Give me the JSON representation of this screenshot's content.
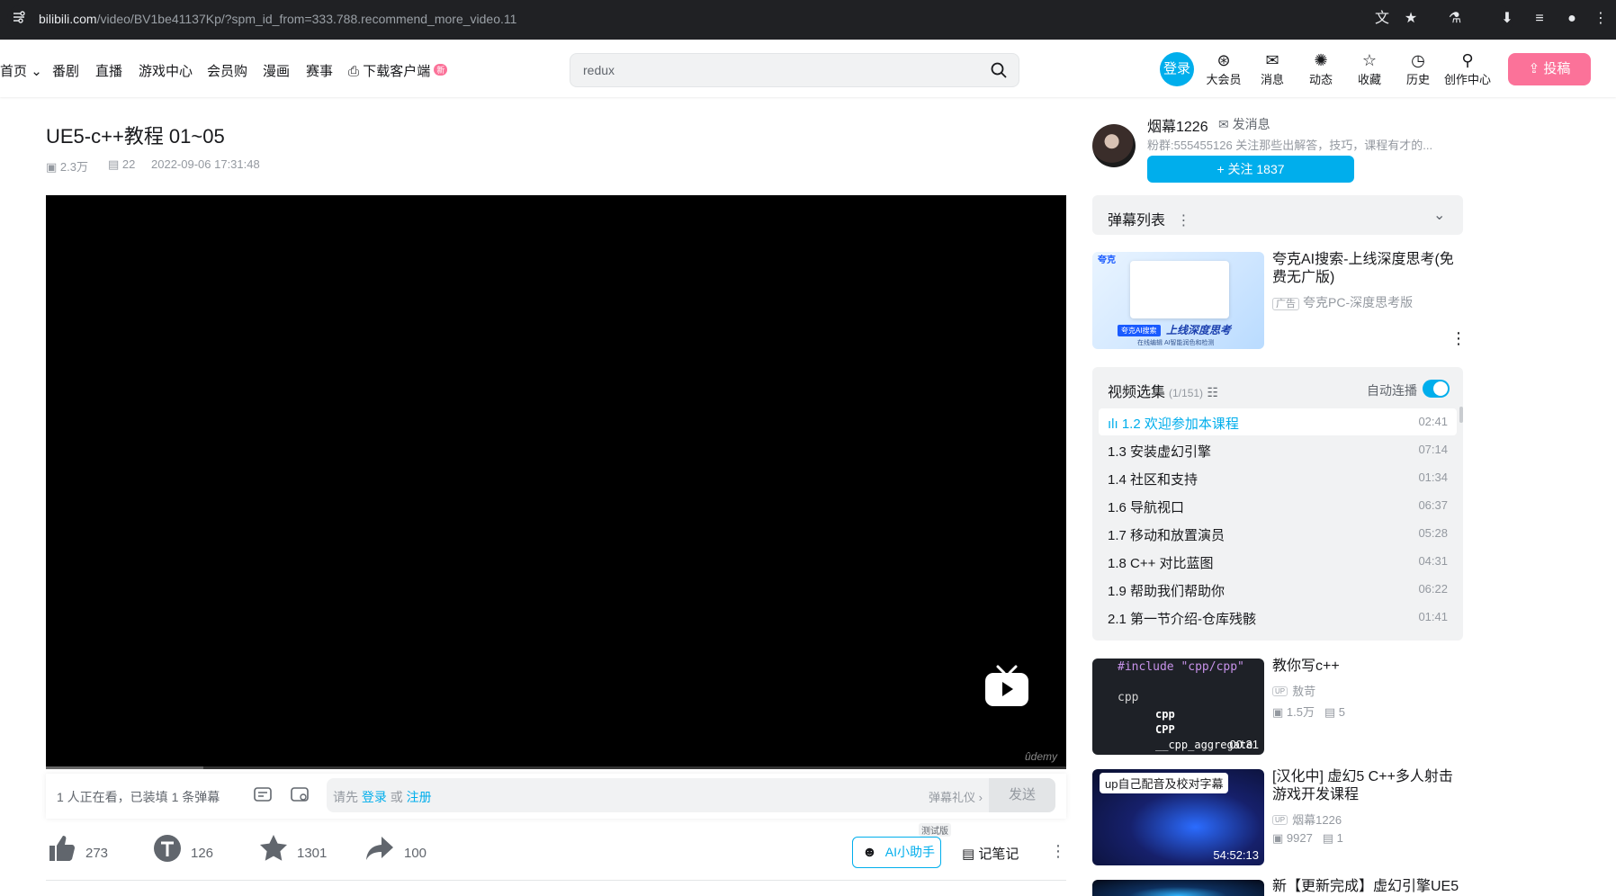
{
  "browser": {
    "url_host": "bilibili.com",
    "url_path": "/video/BV1be41137Kp/?spm_id_from=333.788.recommend_more_video.11"
  },
  "nav": {
    "items": [
      "首页",
      "番剧",
      "直播",
      "游戏中心",
      "会员购",
      "漫画",
      "赛事",
      "下载客户端"
    ],
    "new_badge": "新",
    "search_value": "redux",
    "login_label": "登录",
    "icons": [
      {
        "label": "大会员",
        "icon": "vip-icon"
      },
      {
        "label": "消息",
        "icon": "message-icon"
      },
      {
        "label": "动态",
        "icon": "dynamic-icon"
      },
      {
        "label": "收藏",
        "icon": "star-icon"
      },
      {
        "label": "历史",
        "icon": "history-icon"
      },
      {
        "label": "创作中心",
        "icon": "creator-icon"
      }
    ],
    "upload_label": "投稿"
  },
  "video": {
    "title": "UE5-c++教程 01~05",
    "views": "2.3万",
    "danmaku_count": "22",
    "date": "2022-09-06 17:31:48",
    "watermark": "ûdemy"
  },
  "danmaku_bar": {
    "watching": "1 人正在看，已装填 1 条弹幕",
    "hint_prefix": "请先",
    "hint_login": "登录",
    "hint_or": "或",
    "hint_register": "注册",
    "gift": "弹幕礼仪 ›",
    "send": "发送"
  },
  "actions": {
    "like": "273",
    "coin": "126",
    "favorite": "1301",
    "share": "100",
    "ai_label": "AI小助手",
    "ai_badge": "测试版",
    "note_label": "记笔记"
  },
  "uploader": {
    "name": "烟幕1226",
    "message": "发消息",
    "desc": "粉群:555455126 关注那些出解答，技巧，课程有才的...",
    "follow": "+ 关注 1837"
  },
  "danmaku_list": {
    "title": "弹幕列表"
  },
  "ad": {
    "title": "夸克AI搜索-上线深度思考(免费无广版)",
    "tag": "广告",
    "source": "夸克PC-深度思考版",
    "img_brand": "夸克",
    "img_slogan": "上线深度思考",
    "img_chip": "夸克AI搜索",
    "img_footer": "在线编辑 AI智能润色和检测"
  },
  "playlist": {
    "title": "视频选集",
    "count": "(1/151)",
    "autoplay": "自动连播",
    "items": [
      {
        "title": "1.2 欢迎参加本课程",
        "duration": "02:41"
      },
      {
        "title": "1.3 安装虚幻引擎",
        "duration": "07:14"
      },
      {
        "title": "1.4 社区和支持",
        "duration": "01:34"
      },
      {
        "title": "1.6 导航视口",
        "duration": "06:37"
      },
      {
        "title": "1.7 移动和放置演员",
        "duration": "05:28"
      },
      {
        "title": "1.8 C++ 对比蓝图",
        "duration": "04:31"
      },
      {
        "title": "1.9 帮助我们帮助你",
        "duration": "06:22"
      },
      {
        "title": "2.1 第一节介绍-仓库残骸",
        "duration": "01:41"
      }
    ]
  },
  "recommendations": [
    {
      "title": "教你写c++",
      "up": "敖苛",
      "views": "1.5万",
      "danmaku": "5",
      "duration": "00:31",
      "thumb_code": "#include \"cpp/cpp\"",
      "thumb_input": "cpp",
      "thumb_opts": [
        "cpp",
        "CPP",
        "__cpp_aggregate"
      ]
    },
    {
      "title": "[汉化中] 虚幻5 C++多人射击游戏开发课程",
      "up": "烟幕1226",
      "views": "9927",
      "danmaku": "1",
      "duration": "54:52:13",
      "thumb_tag": "up自己配音及校对字幕"
    },
    {
      "title": "新【更新完成】虚幻引擎UE5"
    }
  ]
}
